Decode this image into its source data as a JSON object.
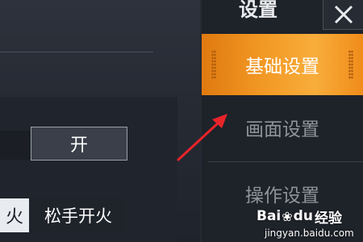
{
  "header": {
    "title": "设置",
    "close_icon": "close-icon"
  },
  "menu": {
    "items": [
      {
        "label": "基础设置",
        "active": true
      },
      {
        "label": "画面设置",
        "active": false
      },
      {
        "label": "操作设置",
        "active": false
      }
    ],
    "active_color": "#f39a26"
  },
  "controls": {
    "toggle_label": "开",
    "fire_partial": "火",
    "release_fire_label": "松手开火"
  },
  "annotation": {
    "arrow_color": "#e8242a"
  },
  "watermark": {
    "brand_bai": "Bai",
    "brand_du": "du",
    "brand_cn": "经验",
    "url": "jingyan.baidu.com"
  }
}
